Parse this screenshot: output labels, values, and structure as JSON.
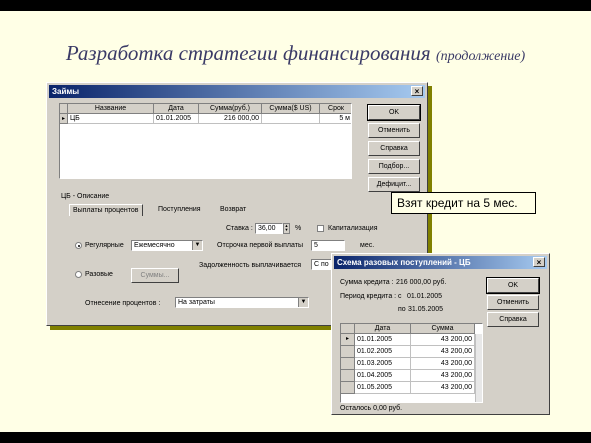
{
  "slide": {
    "title": "Разработка стратегии финансирования",
    "subtitle": "(продолжение)"
  },
  "loans": {
    "title": "Займы",
    "columns": [
      "Название",
      "Дата",
      "Сумма(руб.)",
      "Сумма($ US)",
      "Срок"
    ],
    "row": {
      "name": "ЦБ",
      "date": "01.01.2005",
      "rub": "216 000,00",
      "usd": "",
      "term": "5 м"
    },
    "buttons": {
      "ok": "OK",
      "cancel": "Отменить",
      "help": "Справка",
      "select": "Подбор...",
      "deficit": "Дефицит..."
    },
    "group": "ЦБ - Описание",
    "tabs": [
      "Выплаты процентов",
      "Поступления",
      "Возврат"
    ],
    "rate_label": "Ставка :",
    "rate_value": "36,00",
    "rate_unit": "%",
    "capitalization": "Капитализация",
    "regular_label": "Регулярные",
    "regular_value": "Ежемесячно",
    "delay_label": "Отсрочка первой выплаты",
    "delay_value": "5",
    "delay_unit": "мес.",
    "debt_label": "Задолженность выплачивается",
    "debt_value": "С по",
    "onetime_label": "Разовые",
    "sums_button": "Суммы...",
    "attrib_label": "Отнесение процентов :",
    "attrib_value": "На затраты"
  },
  "callout": "Взят кредит на 5 мес.",
  "schedule": {
    "title": "Схема разовых поступлений - ЦБ",
    "amount_label": "Сумма кредита :",
    "amount_value": "216 000,00 руб.",
    "period_label": "Период кредита :",
    "from_label": "с",
    "from_value": "01.01.2005",
    "to_label": "по",
    "to_value": "31.05.2005",
    "columns": [
      "Дата",
      "Сумма"
    ],
    "rows": [
      {
        "date": "01.01.2005",
        "sum": "43 200,00"
      },
      {
        "date": "01.02.2005",
        "sum": "43 200,00"
      },
      {
        "date": "01.03.2005",
        "sum": "43 200,00"
      },
      {
        "date": "01.04.2005",
        "sum": "43 200,00"
      },
      {
        "date": "01.05.2005",
        "sum": "43 200,00"
      }
    ],
    "remainder": "Осталось 0,00 руб.",
    "buttons": {
      "ok": "OK",
      "cancel": "Отменить",
      "help": "Справка"
    }
  }
}
